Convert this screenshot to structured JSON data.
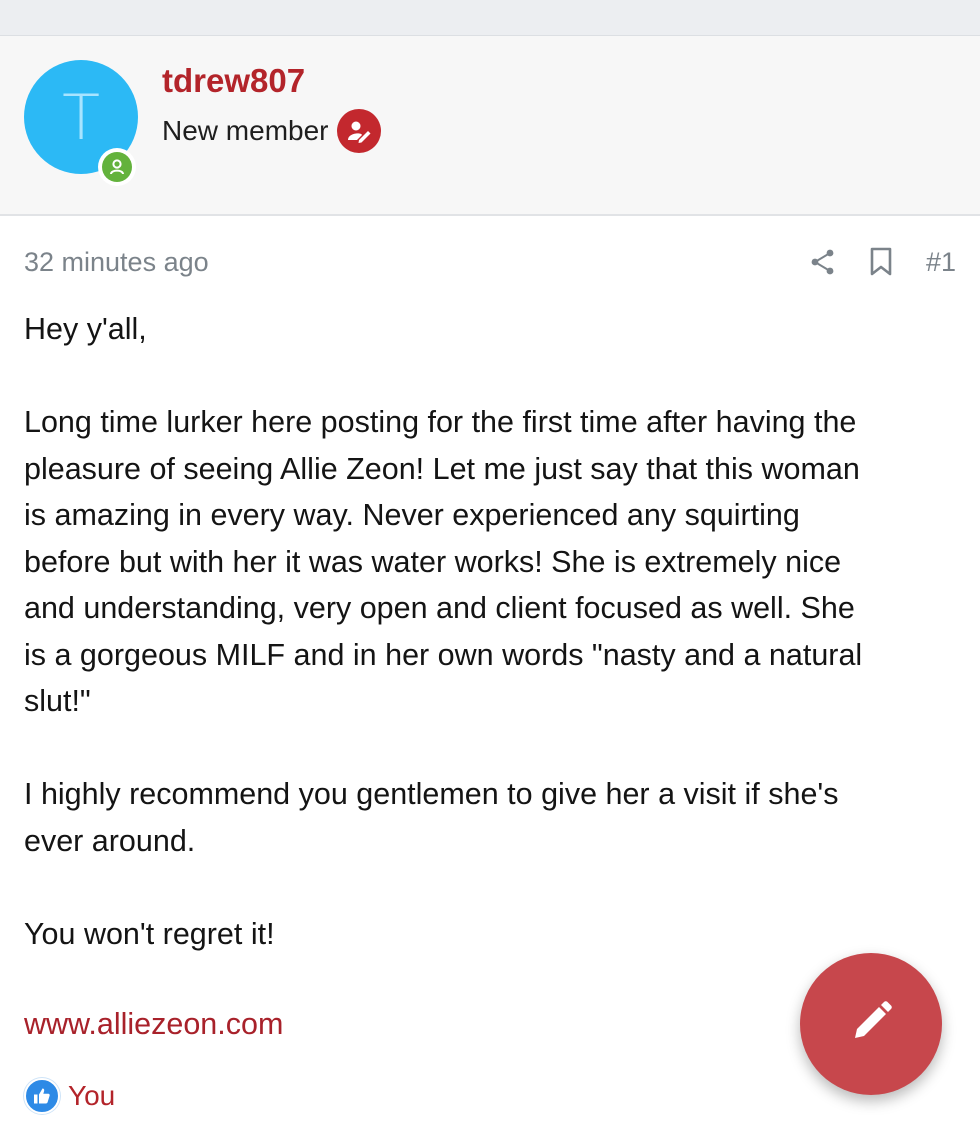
{
  "user": {
    "avatar_letter": "T",
    "username": "tdrew807",
    "title": "New member",
    "online_icon": "user-online-icon",
    "title_icon": "user-edit-icon",
    "avatar_color": "#2cb9f5",
    "username_color": "#b3242a"
  },
  "post": {
    "date": "32 minutes ago",
    "number": "#1",
    "paragraphs": [
      "Hey y'all,",
      "Long time lurker here posting for the first time after having the\npleasure of seeing Allie Zeon! Let me just say that this woman\nis amazing in every way. Never experienced any squirting\nbefore but with her it was water works! She is extremely nice\nand understanding, very open and client focused as well. She\nis a gorgeous MILF and in her own words \"nasty and a natural\nslut!\"",
      "I highly recommend you gentlemen to give her a visit if she's\never around.",
      "You won't regret it!"
    ],
    "link": "www.alliezeon.com"
  },
  "reactions": {
    "icon": "thumbs-up-icon",
    "user": "You"
  },
  "fab": {
    "icon": "pencil-icon",
    "color": "#c7474c"
  }
}
